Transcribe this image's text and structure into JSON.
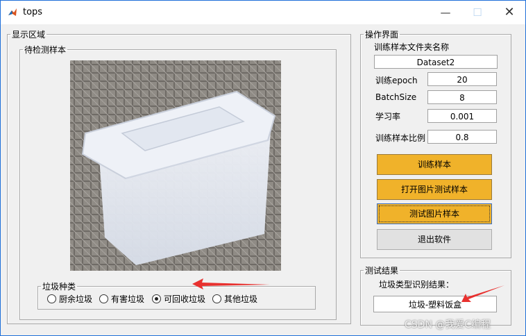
{
  "window": {
    "title": "tops"
  },
  "display": {
    "group_title": "显示区域",
    "sample_group_title": "待检测样本",
    "category_group_title": "垃圾种类",
    "categories": [
      {
        "label": "厨余垃圾",
        "selected": false
      },
      {
        "label": "有害垃圾",
        "selected": false
      },
      {
        "label": "可回收垃圾",
        "selected": true
      },
      {
        "label": "其他垃圾",
        "selected": false
      }
    ]
  },
  "operations": {
    "group_title": "操作界面",
    "folder_label": "训练样本文件夹名称",
    "folder_value": "Dataset2",
    "epoch_label": "训练epoch",
    "epoch_value": "20",
    "batch_label": "BatchSize",
    "batch_value": "8",
    "lr_label": "学习率",
    "lr_value": "0.001",
    "ratio_label": "训练样本比例",
    "ratio_value": "0.8",
    "train_button": "训练样本",
    "open_image_button": "打开图片测试样本",
    "test_image_button": "测试图片样本",
    "exit_button": "退出软件"
  },
  "results": {
    "group_title": "测试结果",
    "result_label": "垃圾类型识别结果：",
    "result_value": "垃圾-塑料饭盒"
  },
  "watermark": "CSDN @我爱C编程"
}
